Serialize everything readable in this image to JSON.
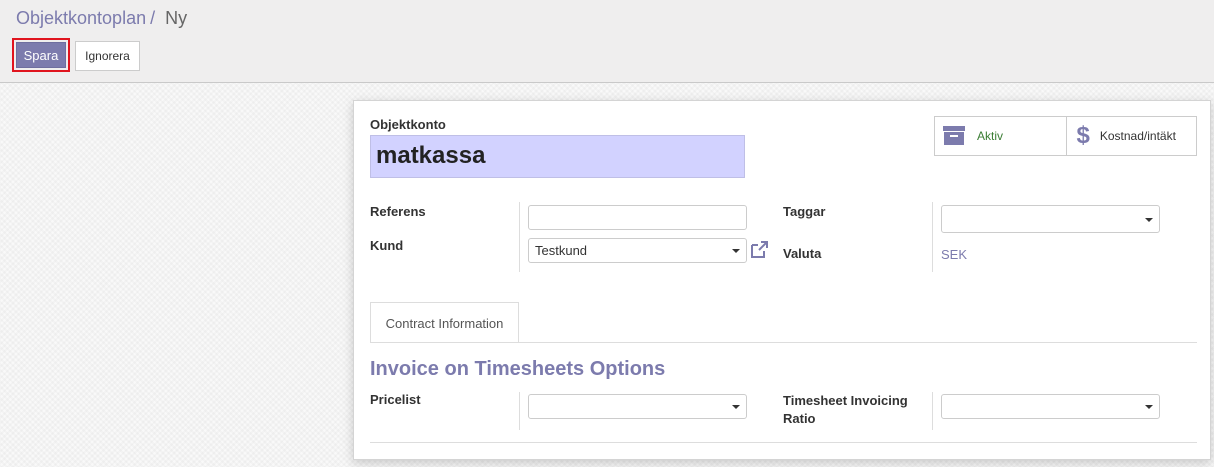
{
  "breadcrumb": {
    "parent": "Objektkontoplan",
    "separator": "/",
    "current": "Ny"
  },
  "toolbar": {
    "save_label": "Spara",
    "discard_label": "Ignorera"
  },
  "form": {
    "name_label": "Objektkonto",
    "name_value": "matkassa",
    "stat_buttons": {
      "active_label": "Aktiv",
      "cost_revenue_label": "Kostnad/intäkt"
    },
    "reference_label": "Referens",
    "reference_value": "",
    "customer_label": "Kund",
    "customer_value": "Testkund",
    "tags_label": "Taggar",
    "tags_value": "",
    "currency_label": "Valuta",
    "currency_value": "SEK",
    "tab_label": "Contract Information",
    "group_title": "Invoice on Timesheets Options",
    "pricelist_label": "Pricelist",
    "pricelist_value": "",
    "invoicing_ratio_label_line1": "Timesheet Invoicing",
    "invoicing_ratio_label_line2": "Ratio",
    "invoicing_ratio_value": ""
  },
  "colors": {
    "accent": "#7c7bad",
    "active_green": "#3a7d33",
    "highlight_red": "#e0141e",
    "title_bg": "#d2d2ff"
  },
  "icons": {
    "archive": "archive-icon",
    "dollar": "dollar-icon",
    "external_link": "external-link-icon"
  }
}
